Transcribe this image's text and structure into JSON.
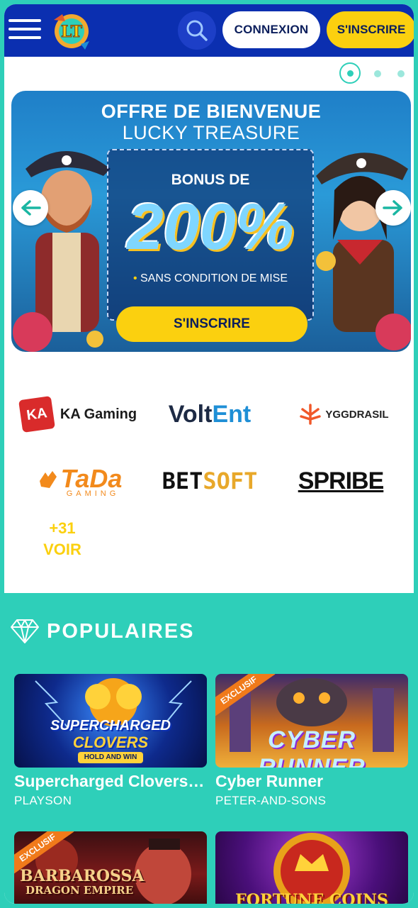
{
  "header": {
    "menu_icon": "hamburger-menu-icon",
    "logo_letters": "LT",
    "search_icon": "search-icon",
    "login_label": "CONNEXION",
    "signup_label": "S'INSCRIRE"
  },
  "carousel": {
    "active_index": 0,
    "slide_count": 3
  },
  "banner": {
    "title": "OFFRE DE BIENVENUE",
    "subtitle": "LUCKY TREASURE",
    "bonus_label": "BONUS DE",
    "bonus_value": "200%",
    "bonus_note": "SANS CONDITION DE MISE",
    "cta_label": "S'INSCRIRE",
    "prev_icon": "arrow-left-icon",
    "next_icon": "arrow-right-icon"
  },
  "providers": {
    "ka_gaming": {
      "badge": "KA",
      "name": "KA Gaming"
    },
    "voltent": {
      "part1": "Volt",
      "part2": "Ent"
    },
    "yggdrasil": {
      "name": "YGGDRASIL"
    },
    "tada": {
      "name": "TaDa",
      "sub": "GAMING"
    },
    "betsoft": {
      "part1": "BET",
      "part2": "SOFT"
    },
    "spribe": {
      "name": "SPRIBE"
    },
    "more_count": "+31",
    "more_label": "VOIR"
  },
  "popular": {
    "icon": "diamond-icon",
    "title": "POPULAIRES",
    "games": [
      {
        "name": "Supercharged Clovers: ...",
        "provider": "PLAYSON",
        "art_title": "SUPERCHARGED",
        "art_title2": "CLOVERS",
        "art_sub": "HOLD AND WIN"
      },
      {
        "name": "Cyber Runner",
        "provider": "PETER-AND-SONS",
        "ribbon": "EXCLUSIF",
        "art_title": "CYBER RUNNER"
      },
      {
        "name": "",
        "provider": "",
        "ribbon": "EXCLUSIF",
        "art_title": "BARBAROSSA",
        "art_title2": "DRAGON EMPIRE"
      },
      {
        "name": "",
        "provider": "",
        "art_title": "FORTUNE COINS"
      }
    ]
  },
  "colors": {
    "header_bg": "#0b2fb0",
    "accent_teal": "#2ecfb9",
    "accent_yellow": "#fbd00f",
    "text_dark": "#0b1e5c",
    "ribbon_orange": "#f07a1a"
  }
}
